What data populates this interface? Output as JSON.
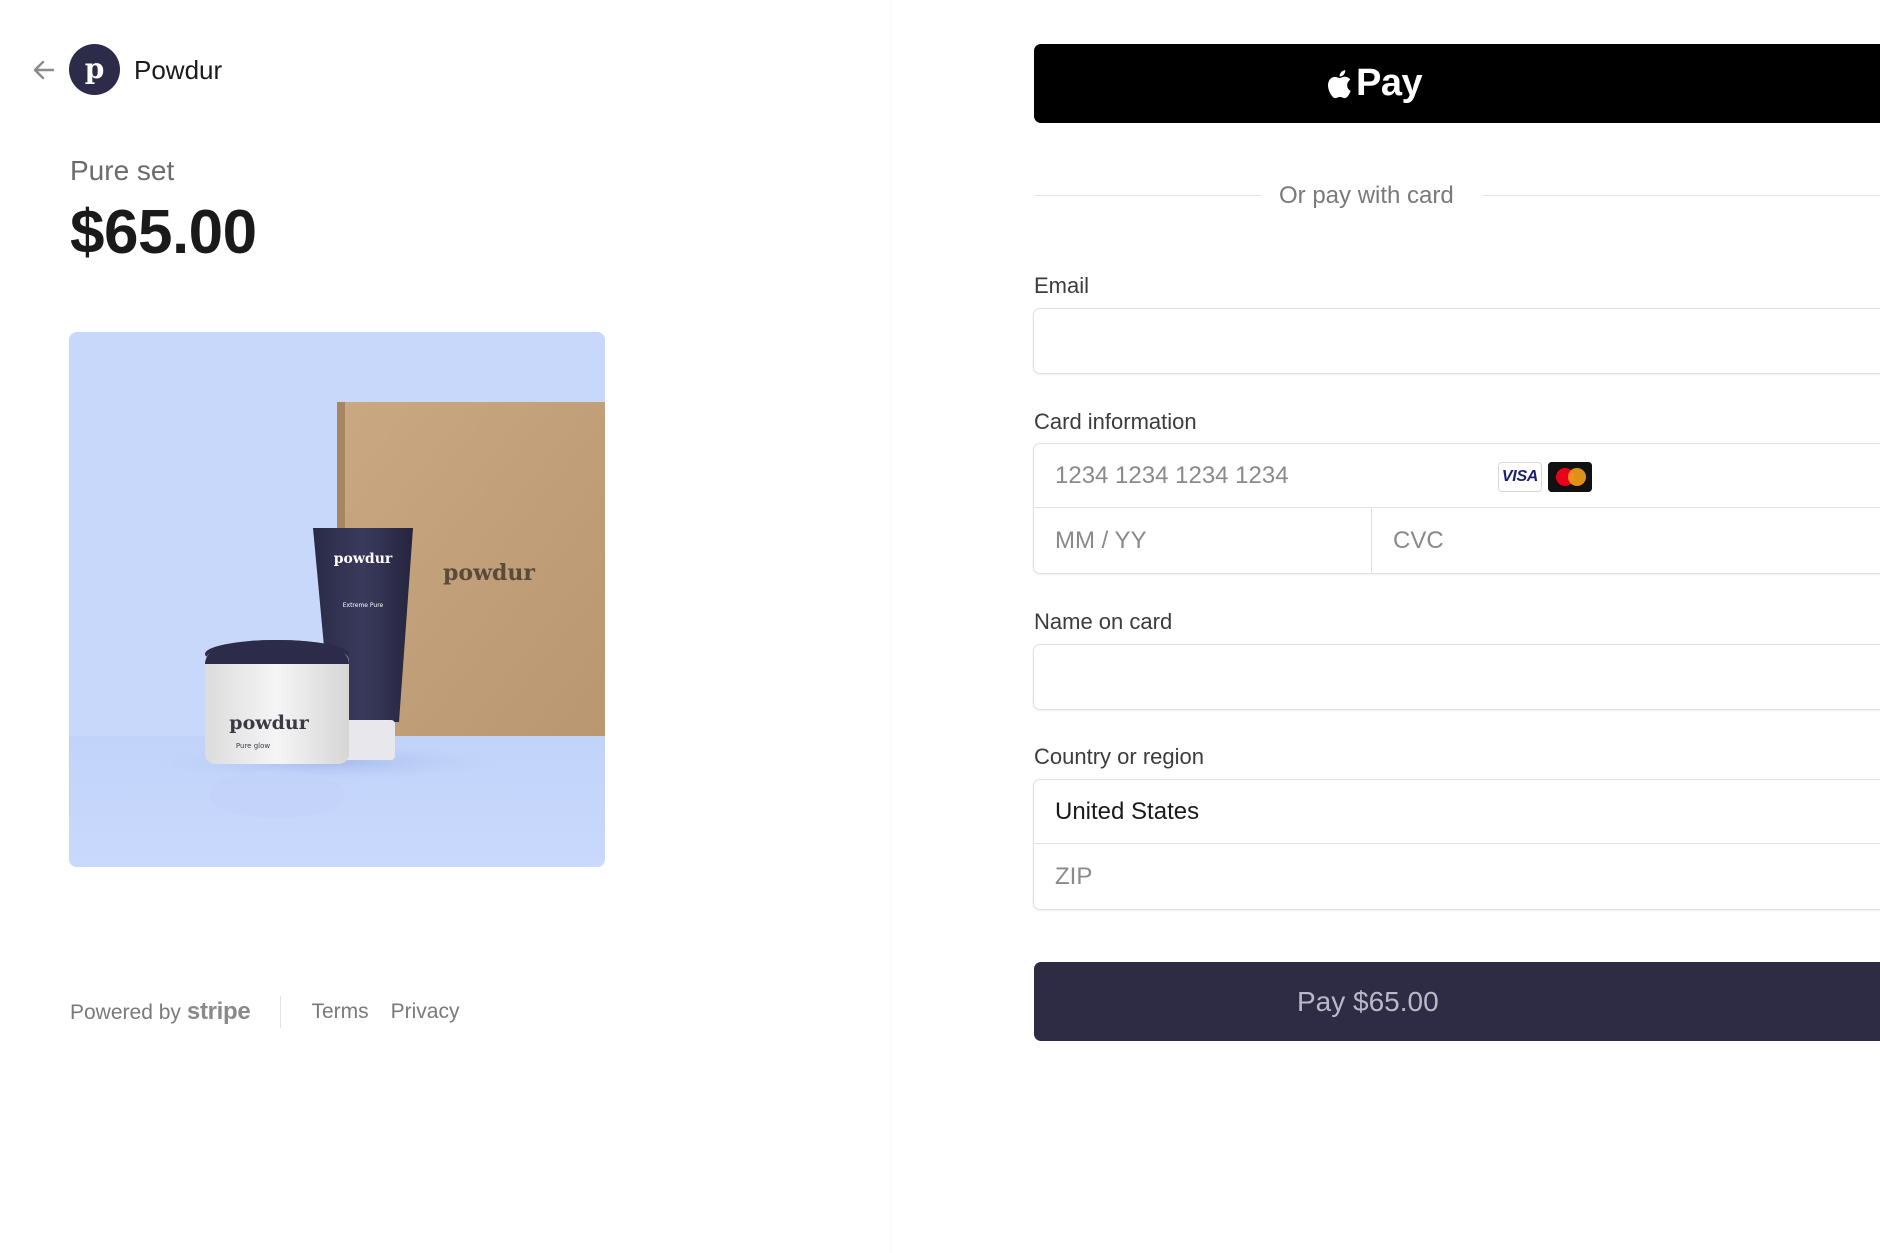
{
  "merchant": {
    "name": "Powdur",
    "logo_letter": "p"
  },
  "product": {
    "name": "Pure set",
    "price": "$65.00",
    "image_labels": {
      "box_brand": "powdur",
      "tube_brand": "powdur",
      "tube_product": "Extreme Pure",
      "jar_brand": "powdur",
      "jar_product": "Pure glow"
    }
  },
  "footer": {
    "powered_by": "Powered by",
    "stripe": "stripe",
    "terms": "Terms",
    "privacy": "Privacy"
  },
  "payment": {
    "apple_pay_label": "Pay",
    "or_divider": "Or pay with card",
    "email_label": "Email",
    "email_value": "",
    "card_label": "Card information",
    "card_number_placeholder": "1234 1234 1234 1234",
    "card_expiry_placeholder": "MM / YY",
    "card_cvc_placeholder": "CVC",
    "card_brand_visa": "VISA",
    "name_label": "Name on card",
    "name_value": "",
    "country_label": "Country or region",
    "country_value": "United States",
    "zip_placeholder": "ZIP",
    "pay_button_label": "Pay $65.00"
  },
  "colors": {
    "brand_dark": "#2e2c45",
    "image_bg": "#c8d8fb",
    "apple_pay_bg": "#000000"
  }
}
